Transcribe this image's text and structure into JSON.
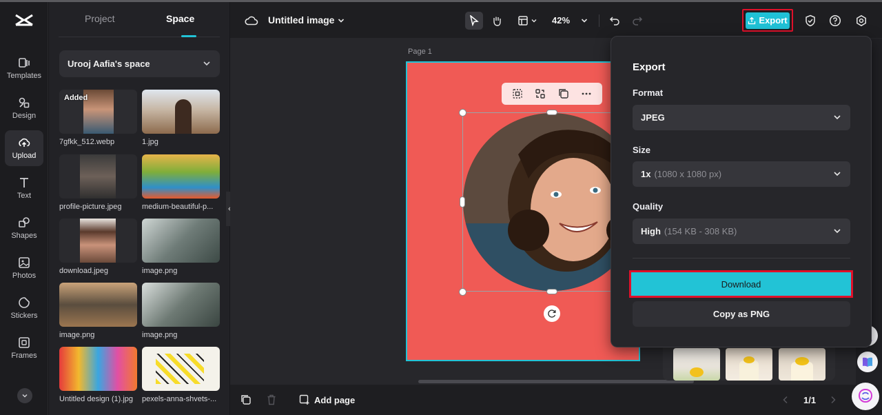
{
  "app": {
    "title": "Untitled image",
    "zoom": "42%"
  },
  "rail": {
    "items": [
      {
        "label": "Templates",
        "icon": "templates-icon"
      },
      {
        "label": "Design",
        "icon": "design-icon"
      },
      {
        "label": "Upload",
        "icon": "upload-icon",
        "active": true
      },
      {
        "label": "Text",
        "icon": "text-icon"
      },
      {
        "label": "Shapes",
        "icon": "shapes-icon"
      },
      {
        "label": "Photos",
        "icon": "photos-icon"
      },
      {
        "label": "Stickers",
        "icon": "stickers-icon"
      },
      {
        "label": "Frames",
        "icon": "frames-icon"
      }
    ]
  },
  "panel": {
    "tabs": [
      {
        "label": "Project"
      },
      {
        "label": "Space",
        "active": true
      }
    ],
    "space_name": "Urooj Aafia's space",
    "added_badge": "Added",
    "media": [
      {
        "name": "7gfkk_512.webp"
      },
      {
        "name": "1.jpg"
      },
      {
        "name": "profile-picture.jpeg"
      },
      {
        "name": "medium-beautiful-p..."
      },
      {
        "name": "download.jpeg"
      },
      {
        "name": "image.png"
      },
      {
        "name": "image.png"
      },
      {
        "name": "image.png"
      },
      {
        "name": "Untitled design (1).jpg"
      },
      {
        "name": "pexels-anna-shvets-..."
      }
    ]
  },
  "toolbar": {
    "export_label": "Export"
  },
  "canvas": {
    "page_label": "Page 1"
  },
  "bottombar": {
    "add_page_label": "Add page",
    "page_count": "1/1"
  },
  "export_dialog": {
    "title": "Export",
    "format_label": "Format",
    "format_value": "JPEG",
    "size_label": "Size",
    "size_value": "1x",
    "size_detail": "(1080 x 1080 px)",
    "quality_label": "Quality",
    "quality_value": "High",
    "quality_detail": "(154 KB - 308 KB)",
    "download_label": "Download",
    "copy_label": "Copy as PNG"
  },
  "colors": {
    "accent": "#22c3d6",
    "highlight": "#e0102a",
    "canvas_bg": "#f05a55"
  }
}
